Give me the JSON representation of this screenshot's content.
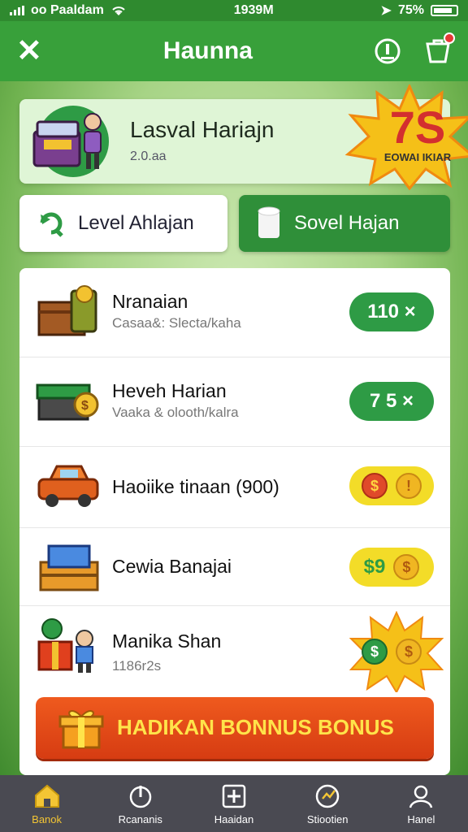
{
  "status_bar": {
    "carrier": "oo Paaldam",
    "time": "1939M",
    "battery": "75%"
  },
  "app_bar": {
    "title": "Haunna"
  },
  "banner": {
    "title": "Lasval Hariajn",
    "subtitle": "2.0.aa",
    "burst_value": "7S",
    "burst_label": "EOWAI IKIAR"
  },
  "tabs": [
    {
      "label": "Level Ahlajan",
      "active": false
    },
    {
      "label": "Sovel Hajan",
      "active": true
    }
  ],
  "items": [
    {
      "title": "Nranaian",
      "subtitle": "Casaa&: Slecta/kaha",
      "reward": "110 ×",
      "icon": "crate-icon"
    },
    {
      "title": "Heveh Harian",
      "subtitle": "Vaaka & olooth/kalra",
      "reward": "7 5 ×",
      "icon": "cash-box-icon"
    },
    {
      "title": "Haoiike tinaan (900)",
      "subtitle": "",
      "reward": "$ !",
      "icon": "toy-car-icon"
    },
    {
      "title": "Cewia Banajai",
      "subtitle": "",
      "reward": "$9 $",
      "icon": "package-icon"
    },
    {
      "title": "Manika Shan",
      "subtitle": "1186r2s",
      "reward": "$ $",
      "icon": "gift-icon"
    }
  ],
  "bonus_button": {
    "label": "HADIKAN BONNUS BONUS"
  },
  "nav": [
    {
      "label": "Banok",
      "icon": "home-icon",
      "active": true
    },
    {
      "label": "Rcananis",
      "icon": "power-icon",
      "active": false
    },
    {
      "label": "Haaidan",
      "icon": "plus-square-icon",
      "active": false
    },
    {
      "label": "Stiootien",
      "icon": "stats-icon",
      "active": false
    },
    {
      "label": "Hanel",
      "icon": "profile-icon",
      "active": false
    }
  ],
  "colors": {
    "primary_green": "#38a03a",
    "accent_red": "#d63c12",
    "accent_yellow": "#f3dc28",
    "nav_bg": "#4a4a52"
  }
}
